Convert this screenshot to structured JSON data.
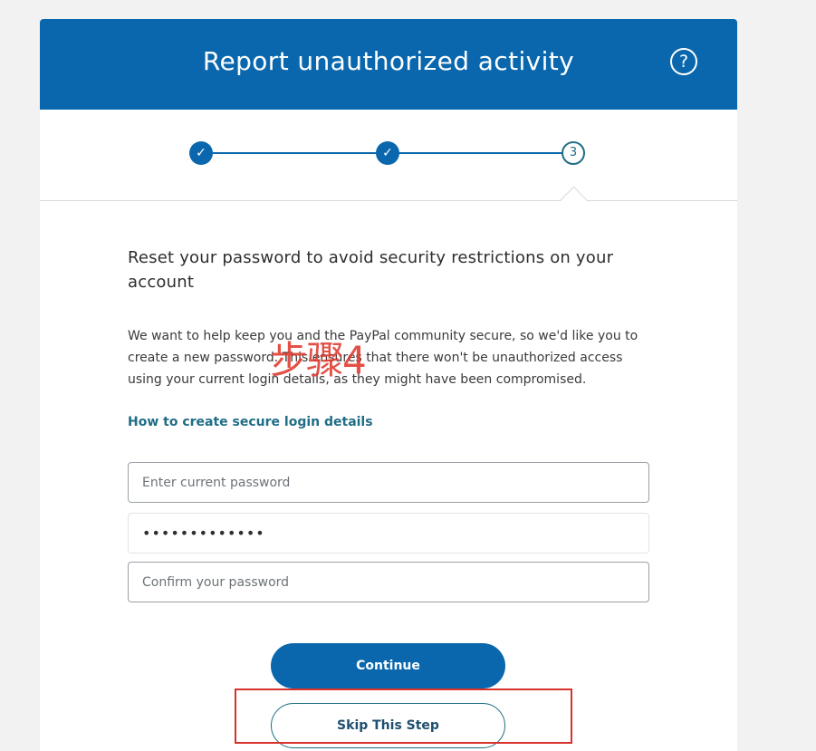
{
  "header": {
    "title": "Report unauthorized activity",
    "help_icon": "question-circle-icon",
    "help_glyph": "?"
  },
  "stepper": {
    "steps": [
      {
        "state": "done",
        "icon": "checkmark-icon",
        "glyph": "✓"
      },
      {
        "state": "done",
        "icon": "checkmark-icon",
        "glyph": "✓"
      },
      {
        "state": "current",
        "label": "3"
      }
    ]
  },
  "content": {
    "heading": "Reset your password to avoid security restrictions on your account",
    "body": "We want to help keep you and the PayPal community secure, so we'd like you to create a new password. This ensures that there won't be unauthorized access using your current login details, as they might have been compromised.",
    "link": "How to create secure login details"
  },
  "form": {
    "current_password": {
      "placeholder": "Enter current password",
      "value": ""
    },
    "new_password": {
      "value": "•••••••••••••"
    },
    "confirm_password": {
      "placeholder": "Confirm your password",
      "value": ""
    }
  },
  "buttons": {
    "continue": "Continue",
    "skip": "Skip This Step"
  },
  "annotation": {
    "text": "步骤4",
    "color": "#e0382c"
  },
  "colors": {
    "brand_blue": "#0a67ad",
    "link_teal": "#1f6d86",
    "annotation_red": "#d8332a"
  }
}
